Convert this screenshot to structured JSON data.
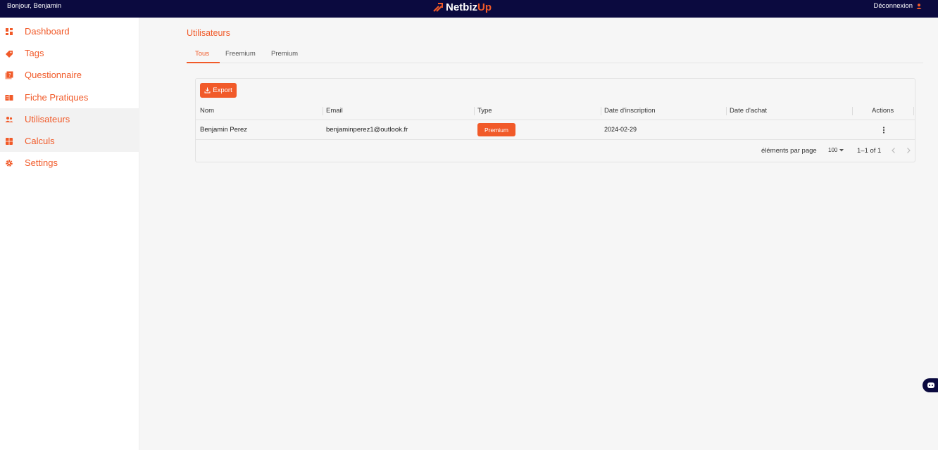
{
  "header": {
    "greeting": "Bonjour, Benjamin",
    "brand_part1": "Netbiz",
    "brand_part2": "Up",
    "logout_label": "Déconnexion"
  },
  "colors": {
    "accent": "#f15a29",
    "topbar": "#0b0a3f"
  },
  "sidebar": {
    "items": [
      {
        "label": "Dashboard",
        "icon": "dashboard-icon"
      },
      {
        "label": "Tags",
        "icon": "tag-icon"
      },
      {
        "label": "Questionnaire",
        "icon": "quiz-icon"
      },
      {
        "label": "Fiche Pratiques",
        "icon": "book-icon"
      },
      {
        "label": "Utilisateurs",
        "icon": "users-icon",
        "active": true
      },
      {
        "label": "Calculs",
        "icon": "calculator-icon"
      },
      {
        "label": "Settings",
        "icon": "gear-icon"
      }
    ]
  },
  "main": {
    "title": "Utilisateurs",
    "tabs": [
      {
        "label": "Tous",
        "active": true
      },
      {
        "label": "Freemium"
      },
      {
        "label": "Premium"
      }
    ],
    "export_label": "Export",
    "table": {
      "columns": [
        "Nom",
        "Email",
        "Type",
        "Date d'inscription",
        "Date d'achat",
        "Actions"
      ],
      "rows": [
        {
          "nom": "Benjamin Perez",
          "email": "benjaminperez1@outlook.fr",
          "type": "Premium",
          "date_inscription": "2024-02-29",
          "date_achat": ""
        }
      ]
    },
    "pagination": {
      "rows_per_page_label": "éléments par page",
      "rows_per_page_value": "100",
      "range": "1–1 of 1"
    }
  }
}
